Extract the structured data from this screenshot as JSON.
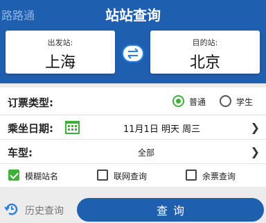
{
  "header": {
    "app_name": "路路通",
    "title": "站站查询"
  },
  "stations": {
    "from_label": "出发站:",
    "from_city": "上海",
    "to_label": "目的站:",
    "to_city": "北京"
  },
  "ticket_type": {
    "label": "订票类型:",
    "options": [
      {
        "label": "普通",
        "checked": true
      },
      {
        "label": "学生",
        "checked": false
      }
    ]
  },
  "date": {
    "label": "乘坐日期:",
    "value": "11月1日  明天  周三"
  },
  "train_type": {
    "label": "车型:",
    "value": "全部"
  },
  "options": [
    {
      "label": "模糊站名",
      "checked": true
    },
    {
      "label": "联网查询",
      "checked": false
    },
    {
      "label": "余票查询",
      "checked": false
    }
  ],
  "footer": {
    "history_label": "历史查询",
    "query_label": "查询"
  },
  "colors": {
    "primary": "#1f5fb0",
    "accent_green": "#3fae3a",
    "background": "#ececec"
  }
}
